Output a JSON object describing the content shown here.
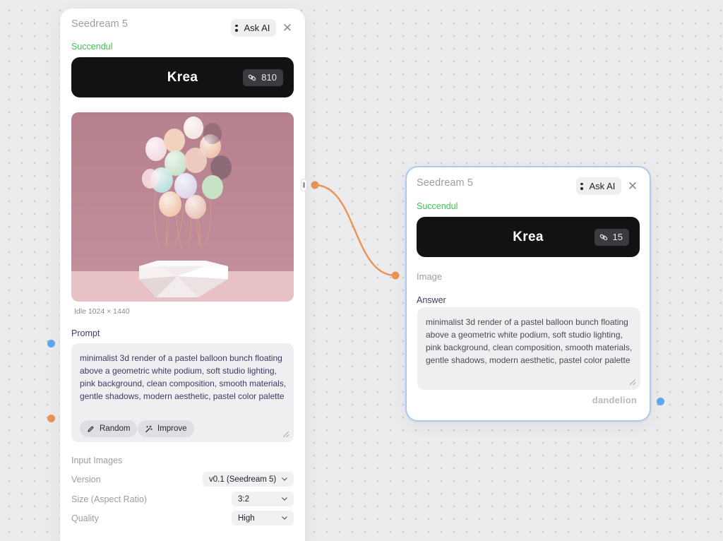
{
  "colors": {
    "canvas_bg": "#ececef",
    "success": "#3fc24d",
    "wire": "#e99356",
    "port_blue": "#5fa8ee",
    "port_orange": "#e99356",
    "selected_border": "#a9c9ef",
    "krea_bar": "#121214"
  },
  "node_left": {
    "title": "Seedream 5",
    "ask_ai_label": "Ask AI",
    "close_icon": "close-icon",
    "status": "Succendul",
    "run_button": {
      "label": "Krea",
      "credits": "810",
      "icon": "link-icon"
    },
    "image_meta": "Idle 1024 × 1440",
    "prompt_label": "Prompt",
    "prompt_text": "minimalist 3d render of a pastel balloon bunch floating above a geometric white podium, soft studio lighting, pink background, clean composition, smooth materials, gentle shadows, modern aesthetic, pastel color palette",
    "random_label": "Random",
    "improve_label": "Improve",
    "input_images_label": "Input Images",
    "version_label": "Version",
    "version_value": "v0.1 (Seedream 5)",
    "size_label": "Size (Aspect Ratio)",
    "size_value": "3:2",
    "quality_label": "Quality",
    "quality_value": "High"
  },
  "node_right": {
    "title": "Seedream 5",
    "ask_ai_label": "Ask AI",
    "status": "Succendul",
    "run_button": {
      "label": "Krea",
      "credits": "15",
      "icon": "link-icon"
    },
    "image_label": "Image",
    "answer_label": "Answer",
    "answer_text": "minimalist 3d render of a pastel balloon bunch floating above a geometric white podium, soft studio lighting, pink background, clean composition, smooth materials, gentle shadows, modern aesthetic, pastel color palette",
    "model_tag": "dandelion"
  }
}
